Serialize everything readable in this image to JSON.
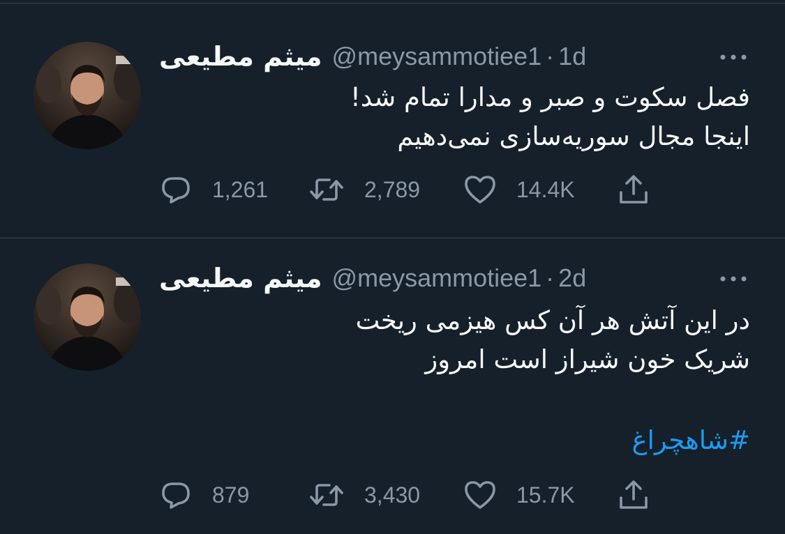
{
  "tweets": [
    {
      "display_name": "میثم مطیعی",
      "handle": "@meysammotiee1",
      "separator": "·",
      "time": "1d",
      "text": "فصل سکوت و صبر و مدارا تمام شد!\nاینجا مجال سوریه‌سازی نمی‌دهیم",
      "hashtag": "",
      "replies": "1,261",
      "retweets": "2,789",
      "likes": "14.4K"
    },
    {
      "display_name": "میثم مطیعی",
      "handle": "@meysammotiee1",
      "separator": "·",
      "time": "2d",
      "text": "در این آتش هر آن کس هیزمی ریخت\nشریک خون شیراز است امروز",
      "hashtag": "#شاهچراغ",
      "replies": "879",
      "retweets": "3,430",
      "likes": "15.7K"
    }
  ],
  "icons": {
    "reply": "speech-bubble-icon",
    "retweet": "retweet-arrows-icon",
    "like": "heart-outline-icon",
    "share": "share-upload-icon",
    "more": "more-dots-icon"
  },
  "colors": {
    "background": "#15202b",
    "divider": "#38444d",
    "primary_text": "#f7f9f9",
    "secondary_text": "#8b98a5",
    "link": "#1d9bf0"
  }
}
